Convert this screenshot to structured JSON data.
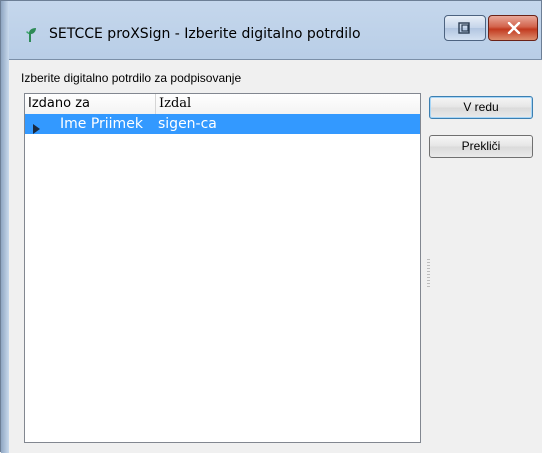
{
  "window": {
    "title": "SETCCE proXSign - Izberite digitalno potrdilo"
  },
  "dialog": {
    "prompt": "Izberite digitalno potrdilo za podpisovanje",
    "columns": [
      "Izdano za",
      "Izdal"
    ],
    "rows": [
      {
        "issued_to": "Ime Priimek",
        "issuer": "sigen-ca",
        "selected": true
      }
    ],
    "ok_label": "V redu",
    "cancel_label": "Prekliči"
  },
  "colors": {
    "selection": "#3399ff",
    "app_icon": "#2e8b57"
  },
  "icons": {
    "app": "leaf-icon",
    "restore": "restore-icon",
    "close": "close-icon",
    "row_expander": "triangle-right-icon"
  }
}
